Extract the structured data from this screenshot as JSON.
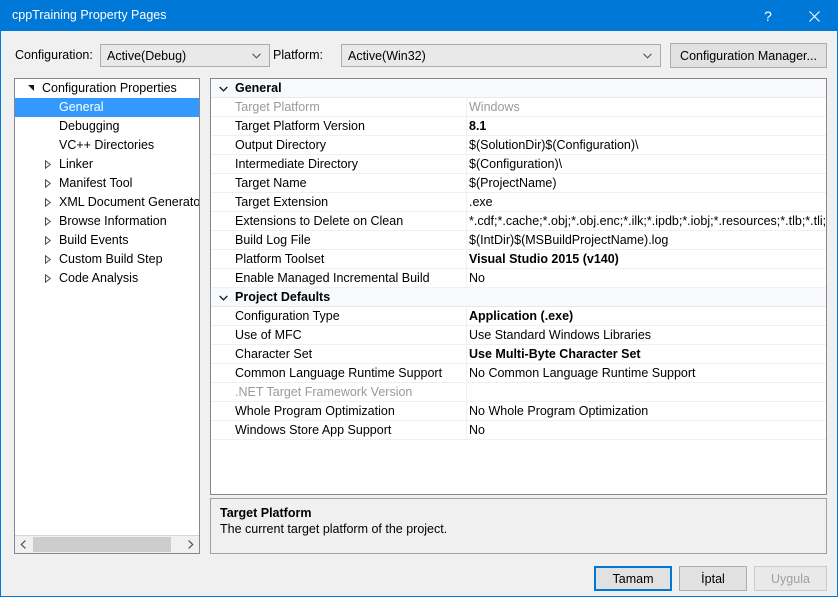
{
  "window": {
    "title": "cppTraining Property Pages",
    "help_icon": "question-mark-icon",
    "close_icon": "close-icon"
  },
  "toolbar": {
    "configuration_label": "Configuration:",
    "configuration_value": "Active(Debug)",
    "platform_label": "Platform:",
    "platform_value": "Active(Win32)",
    "configuration_manager_label": "Configuration Manager..."
  },
  "tree": {
    "items": [
      {
        "label": "Configuration Properties",
        "level": 0,
        "state": "expanded",
        "selected": false
      },
      {
        "label": "General",
        "level": 1,
        "state": "leaf",
        "selected": true
      },
      {
        "label": "Debugging",
        "level": 1,
        "state": "leaf",
        "selected": false
      },
      {
        "label": "VC++ Directories",
        "level": 1,
        "state": "leaf",
        "selected": false
      },
      {
        "label": "Linker",
        "level": 1,
        "state": "collapsed",
        "selected": false
      },
      {
        "label": "Manifest Tool",
        "level": 1,
        "state": "collapsed",
        "selected": false
      },
      {
        "label": "XML Document Generator",
        "level": 1,
        "state": "collapsed",
        "selected": false
      },
      {
        "label": "Browse Information",
        "level": 1,
        "state": "collapsed",
        "selected": false
      },
      {
        "label": "Build Events",
        "level": 1,
        "state": "collapsed",
        "selected": false
      },
      {
        "label": "Custom Build Step",
        "level": 1,
        "state": "collapsed",
        "selected": false
      },
      {
        "label": "Code Analysis",
        "level": 1,
        "state": "collapsed",
        "selected": false
      }
    ],
    "scroll_left_icon": "chevron-left-icon",
    "scroll_right_icon": "chevron-right-icon"
  },
  "grid": {
    "rows": [
      {
        "kind": "section",
        "name": "General",
        "state": "expanded"
      },
      {
        "kind": "prop",
        "name": "Target Platform",
        "value": "Windows",
        "disabled": true,
        "bold": false
      },
      {
        "kind": "prop",
        "name": "Target Platform Version",
        "value": "8.1",
        "disabled": false,
        "bold": true
      },
      {
        "kind": "prop",
        "name": "Output Directory",
        "value": "$(SolutionDir)$(Configuration)\\",
        "disabled": false,
        "bold": false
      },
      {
        "kind": "prop",
        "name": "Intermediate Directory",
        "value": "$(Configuration)\\",
        "disabled": false,
        "bold": false
      },
      {
        "kind": "prop",
        "name": "Target Name",
        "value": "$(ProjectName)",
        "disabled": false,
        "bold": false
      },
      {
        "kind": "prop",
        "name": "Target Extension",
        "value": ".exe",
        "disabled": false,
        "bold": false
      },
      {
        "kind": "prop",
        "name": "Extensions to Delete on Clean",
        "value": "*.cdf;*.cache;*.obj;*.obj.enc;*.ilk;*.ipdb;*.iobj;*.resources;*.tlb;*.tli;*.tlh;*.tmp",
        "disabled": false,
        "bold": false
      },
      {
        "kind": "prop",
        "name": "Build Log File",
        "value": "$(IntDir)$(MSBuildProjectName).log",
        "disabled": false,
        "bold": false
      },
      {
        "kind": "prop",
        "name": "Platform Toolset",
        "value": "Visual Studio 2015 (v140)",
        "disabled": false,
        "bold": true
      },
      {
        "kind": "prop",
        "name": "Enable Managed Incremental Build",
        "value": "No",
        "disabled": false,
        "bold": false
      },
      {
        "kind": "section",
        "name": "Project Defaults",
        "state": "expanded"
      },
      {
        "kind": "prop",
        "name": "Configuration Type",
        "value": "Application (.exe)",
        "disabled": false,
        "bold": true
      },
      {
        "kind": "prop",
        "name": "Use of MFC",
        "value": "Use Standard Windows Libraries",
        "disabled": false,
        "bold": false
      },
      {
        "kind": "prop",
        "name": "Character Set",
        "value": "Use Multi-Byte Character Set",
        "disabled": false,
        "bold": true
      },
      {
        "kind": "prop",
        "name": "Common Language Runtime Support",
        "value": "No Common Language Runtime Support",
        "disabled": false,
        "bold": false
      },
      {
        "kind": "prop",
        "name": ".NET Target Framework Version",
        "value": "",
        "disabled": true,
        "bold": false
      },
      {
        "kind": "prop",
        "name": "Whole Program Optimization",
        "value": "No Whole Program Optimization",
        "disabled": false,
        "bold": false
      },
      {
        "kind": "prop",
        "name": "Windows Store App Support",
        "value": "No",
        "disabled": false,
        "bold": false
      }
    ]
  },
  "description": {
    "title": "Target Platform",
    "text": "The current target platform of the project."
  },
  "footer": {
    "ok_label": "Tamam",
    "cancel_label": "İptal",
    "apply_label": "Uygula"
  },
  "colors": {
    "titlebar": "#0078d7",
    "selection": "#3399ff",
    "dialog_bg": "#f0f0f0",
    "disabled_text": "#9a9a9a"
  }
}
